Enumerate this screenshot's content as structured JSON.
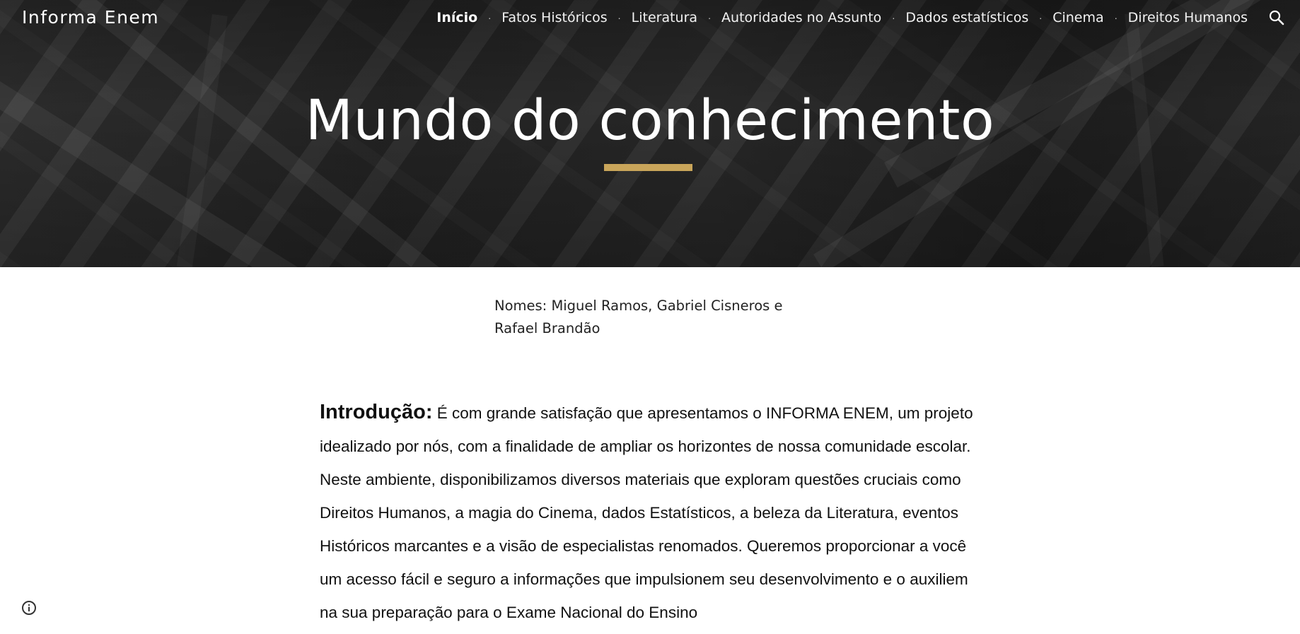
{
  "header": {
    "site_title": "Informa Enem",
    "nav": [
      {
        "label": "Início",
        "active": true
      },
      {
        "label": "Fatos Históricos",
        "active": false
      },
      {
        "label": "Literatura",
        "active": false
      },
      {
        "label": "Autoridades no Assunto",
        "active": false
      },
      {
        "label": "Dados estatísticos",
        "active": false
      },
      {
        "label": "Cinema",
        "active": false
      },
      {
        "label": "Direitos Humanos",
        "active": false
      }
    ],
    "search_icon": "search-icon"
  },
  "hero": {
    "title": "Mundo do conhecimento",
    "accent_color": "#c9a55a"
  },
  "main": {
    "names_line1": "Nomes: Miguel Ramos, Gabriel Cisneros e",
    "names_line2": "Rafael Brandão",
    "intro_heading": "Introdução:",
    "intro_text": " É com grande satisfação que apresentamos o INFORMA ENEM, um projeto idealizado por nós, com a finalidade de ampliar os horizontes de nossa comunidade escolar. Neste ambiente, disponibilizamos diversos materiais que exploram questões cruciais como Direitos Humanos, a magia do Cinema, dados Estatísticos, a beleza da Literatura, eventos Históricos marcantes e a visão de especialistas renomados. Queremos proporcionar a você um acesso fácil e seguro a informações que impulsionem seu desenvolvimento e o auxiliem na sua preparação para o Exame Nacional do Ensino"
  },
  "footer": {
    "info_icon": "info-icon"
  }
}
